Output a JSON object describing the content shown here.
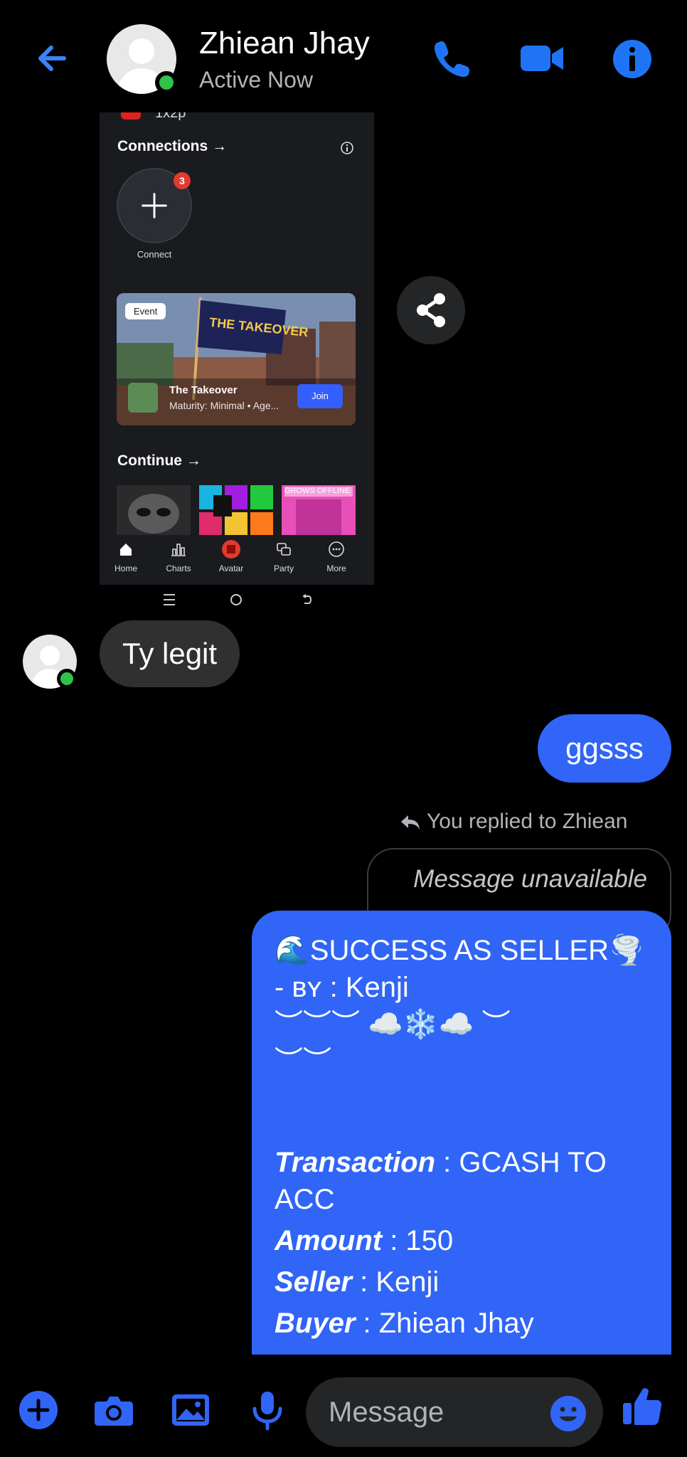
{
  "header": {
    "contact_name": "Zhiean Jhay",
    "status": "Active Now",
    "accent_color": "#3065f7",
    "online_color": "#31c24a",
    "icons": [
      "back-arrow-icon",
      "phone-icon",
      "video-camera-icon",
      "info-icon"
    ]
  },
  "shared_screenshot": {
    "top_text": "1x2p",
    "connections_title": "Connections →",
    "connect_badge": "3",
    "connect_label": "Connect",
    "event": {
      "tag": "Event",
      "banner_text": "THE TAKEOVER",
      "name": "The Takeover",
      "subtitle": "Maturity: Minimal • Age...",
      "join_label": "Join"
    },
    "continue_title": "Continue →",
    "tile_text": "GROWS OFFLINE",
    "nav": [
      {
        "label": "Home",
        "icon": "home-icon"
      },
      {
        "label": "Charts",
        "icon": "charts-icon"
      },
      {
        "label": "Avatar",
        "icon": "avatar-icon"
      },
      {
        "label": "Party",
        "icon": "party-icon"
      },
      {
        "label": "More",
        "icon": "more-icon"
      }
    ]
  },
  "messages": {
    "incoming_1": "Ty legit",
    "outgoing_1": "ggsss",
    "reply_note": "You replied to Zhiean",
    "quoted": "Message unavailable",
    "receipt": {
      "line1": "🌊SUCCESS AS SELLER🌪️",
      "line2": "- ʙʏ : Kenji",
      "line3": "︶︶︶ ☁️❄️☁️ ︶",
      "line4": "︶︶",
      "transaction_label": "Transaction",
      "transaction_value": ": GCASH TO",
      "transaction_value2": "ACC",
      "amount_label": "Amount",
      "amount_value": ": 150",
      "seller_label": "Seller",
      "seller_value": ": Kenji",
      "buyer_label": "Buyer",
      "buyer_value": ": Zhiean Jhay"
    }
  },
  "composer": {
    "placeholder": "Message",
    "icons": [
      "plus-icon",
      "camera-icon",
      "gallery-icon",
      "microphone-icon",
      "emoji-icon",
      "thumbs-up-icon"
    ]
  }
}
